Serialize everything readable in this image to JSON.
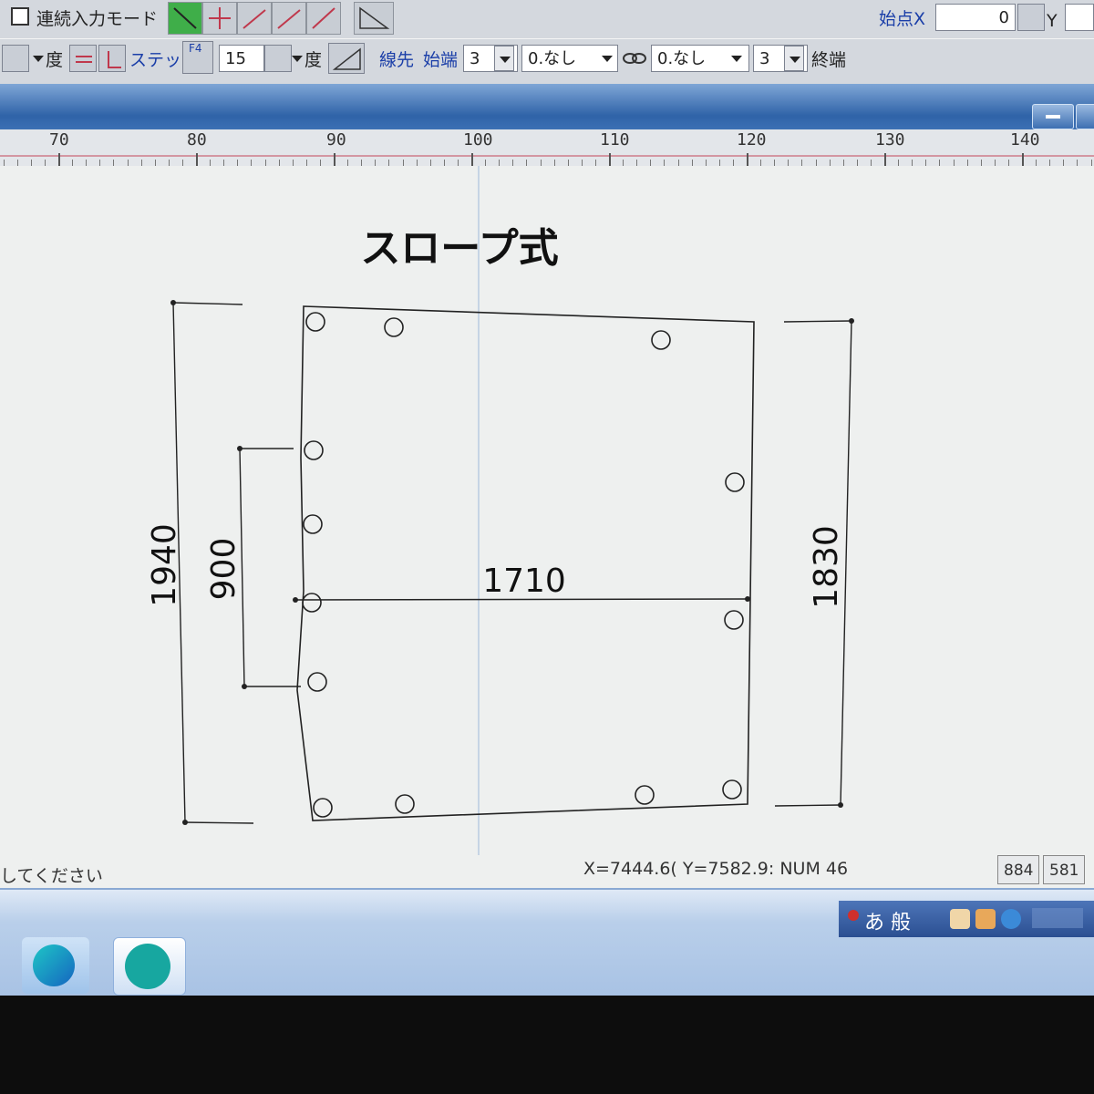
{
  "toolbar": {
    "continuous_input_label": "連続入力モード",
    "start_point_x_label": "始点X",
    "start_point_x_value": "0",
    "start_point_y_label": "Y",
    "degree_label": "度",
    "step_label": "ステップ",
    "f4_label": "F4",
    "step_value": "15",
    "degree_label2": "度",
    "line_tip_label": "線先",
    "start_end_label": "始端",
    "start_end_value": "3",
    "start_style_value": "0.なし",
    "end_style_value": "0.なし",
    "end_value": "3",
    "end_label": "終端"
  },
  "ruler": {
    "labels": [
      "70",
      "80",
      "90",
      "100",
      "110",
      "120",
      "130",
      "140"
    ]
  },
  "drawing": {
    "title": "スロープ式",
    "dim_left_height": "1940",
    "dim_inner_height": "900",
    "dim_width": "1710",
    "dim_right_height": "1830"
  },
  "status": {
    "prompt": "してください",
    "coords": "X=7444.6( Y=7582.9: NUM 46",
    "box1": "884",
    "box2": "581"
  },
  "taskbar": {
    "ime_text": "あ 般"
  },
  "colors": {
    "toolbar_bg": "#d4d8de",
    "title_band": "#2f63a8",
    "canvas_bg": "#eef0ef",
    "label_blue": "#1a3ea8"
  }
}
